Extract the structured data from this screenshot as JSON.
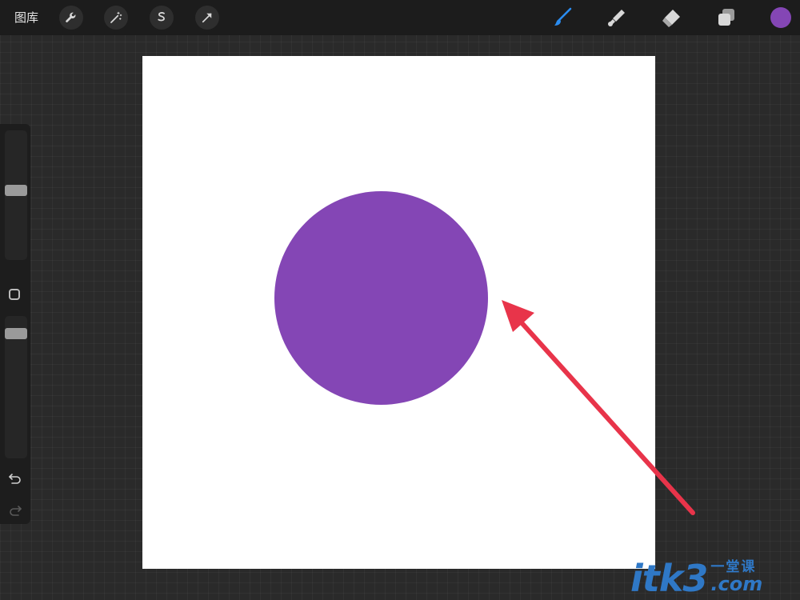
{
  "toolbar": {
    "gallery_label": "图库",
    "left_tools": [
      "wrench-icon",
      "magic-wand-icon",
      "selection-icon",
      "transform-icon"
    ],
    "right_tools": [
      "brush-icon",
      "smudge-icon",
      "eraser-icon",
      "layers-icon"
    ],
    "current_color": "#8446b5"
  },
  "canvas": {
    "background": "#ffffff",
    "circle_color": "#8446b5",
    "arrow_color": "#e8344a"
  },
  "sidebar": {
    "icons": [
      "brush-size-slider",
      "modify-button",
      "opacity-slider",
      "undo-icon",
      "redo-icon"
    ]
  },
  "watermark": {
    "main": "itk3",
    "chinese": "一堂课",
    "suffix": ".com",
    "color": "#2f78c6"
  }
}
